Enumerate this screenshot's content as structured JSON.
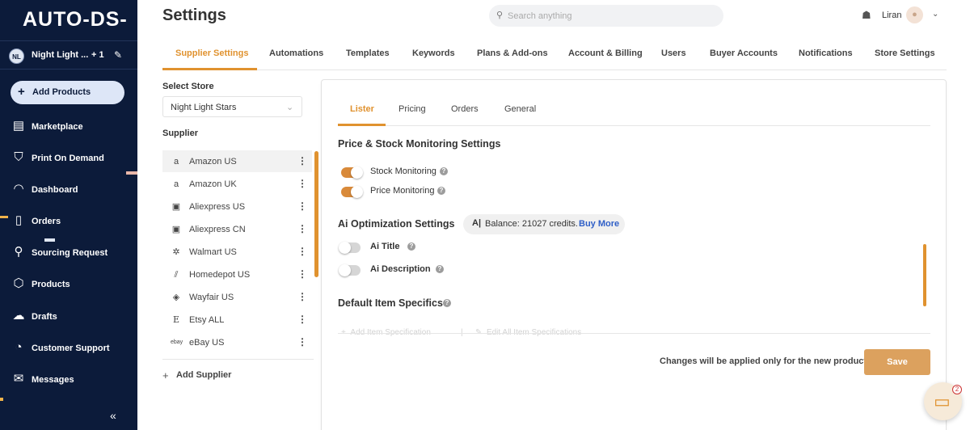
{
  "app": {
    "logo": "AUTO-DS-",
    "page_title": "Settings"
  },
  "sidebar": {
    "store": {
      "badge": "NL",
      "name": "Night Light ...",
      "extra": "+ 1"
    },
    "add_products": "Add Products",
    "items": [
      {
        "label": "Marketplace",
        "icon": "store-icon"
      },
      {
        "label": "Print On Demand",
        "icon": "shirt-icon"
      },
      {
        "label": "Dashboard",
        "icon": "gauge-icon"
      },
      {
        "label": "Orders",
        "icon": "clipboard-icon"
      },
      {
        "label": "Sourcing Request",
        "icon": "person-search-icon"
      },
      {
        "label": "Products",
        "icon": "box-icon"
      },
      {
        "label": "Drafts",
        "icon": "cloud-upload-icon"
      },
      {
        "label": "Customer Support",
        "icon": "headset-icon"
      },
      {
        "label": "Messages",
        "icon": "mail-icon"
      }
    ]
  },
  "header": {
    "search_placeholder": "Search anything",
    "user_name": "Liran"
  },
  "top_tabs": [
    "Supplier Settings",
    "Automations",
    "Templates",
    "Keywords",
    "Plans & Add-ons",
    "Account & Billing",
    "Users",
    "Buyer Accounts",
    "Notifications",
    "Store Settings"
  ],
  "supplier_panel": {
    "select_store_label": "Select Store",
    "selected_store": "Night Light Stars",
    "supplier_label": "Supplier",
    "suppliers": [
      "Amazon US",
      "Amazon UK",
      "Aliexpress US",
      "Aliexpress CN",
      "Walmart US",
      "Homedepot US",
      "Wayfair US",
      "Etsy ALL",
      "eBay US"
    ],
    "add_supplier": "Add Supplier"
  },
  "sub_tabs": [
    "Lister",
    "Pricing",
    "Orders",
    "General"
  ],
  "price_stock": {
    "title": "Price & Stock Monitoring Settings",
    "stock_monitoring": "Stock Monitoring",
    "price_monitoring": "Price Monitoring"
  },
  "ai": {
    "title": "Ai Optimization Settings",
    "balance_text": "Balance: 21027 credits.",
    "buy_more": "Buy More",
    "ai_title": "Ai Title",
    "ai_description": "Ai Description"
  },
  "item_specifics": {
    "title": "Default Item Specifics",
    "add_spec": "Add Item Specification",
    "edit_all": "Edit All Item Specifications"
  },
  "footer": {
    "note": "Changes will be applied only for the new products",
    "save": "Save"
  },
  "chat": {
    "badge": "2"
  },
  "colors": {
    "sidebar_bg": "#0c1b3a",
    "accent": "#e0922f",
    "link": "#2f5fc7"
  }
}
